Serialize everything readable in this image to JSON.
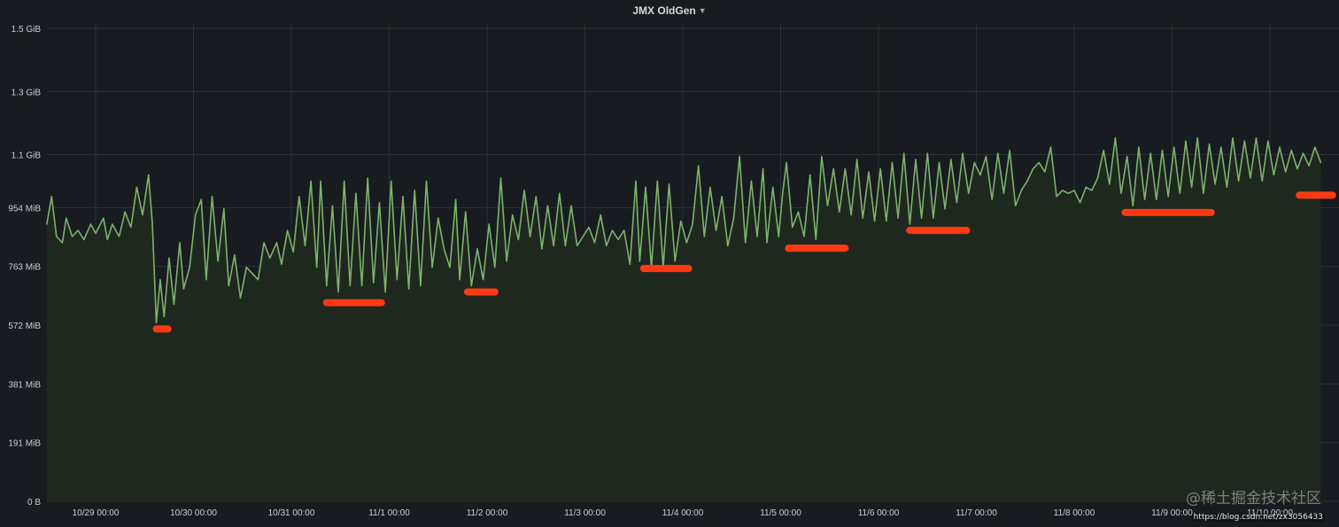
{
  "panel": {
    "title": "JMX OldGen",
    "caret_icon": "caret-down-icon"
  },
  "colors": {
    "background": "#181b1f",
    "series_line": "#7eb26d",
    "series_fill": "#202920",
    "grid": "#2c3036",
    "marker": "#ff3a12"
  },
  "watermark": {
    "text": "@稀土掘金技术社区",
    "url": "https://blog.csdn.net/zx3056433"
  },
  "chart_data": {
    "type": "area",
    "title": "JMX OldGen",
    "xlabel": "",
    "ylabel": "",
    "y_unit": "MiB",
    "ylim": [
      0,
      1536
    ],
    "grid": true,
    "legend": "none",
    "y_ticks": [
      {
        "value": 0,
        "label": "0 B"
      },
      {
        "value": 191,
        "label": "191 MiB"
      },
      {
        "value": 381,
        "label": "381 MiB"
      },
      {
        "value": 572,
        "label": "572 MiB"
      },
      {
        "value": 763,
        "label": "763 MiB"
      },
      {
        "value": 954,
        "label": "954 MiB"
      },
      {
        "value": 1126,
        "label": "1.1 GiB"
      },
      {
        "value": 1331,
        "label": "1.3 GiB"
      },
      {
        "value": 1536,
        "label": "1.5 GiB"
      }
    ],
    "x_range_days": [
      "10/28 13:00",
      "11/10 13:00"
    ],
    "x_ticks": [
      {
        "day": 1,
        "label": "10/29 00:00"
      },
      {
        "day": 2,
        "label": "10/30 00:00"
      },
      {
        "day": 3,
        "label": "10/31 00:00"
      },
      {
        "day": 4,
        "label": "11/1 00:00"
      },
      {
        "day": 5,
        "label": "11/2 00:00"
      },
      {
        "day": 6,
        "label": "11/3 00:00"
      },
      {
        "day": 7,
        "label": "11/4 00:00"
      },
      {
        "day": 8,
        "label": "11/5 00:00"
      },
      {
        "day": 9,
        "label": "11/6 00:00"
      },
      {
        "day": 10,
        "label": "11/7 00:00"
      },
      {
        "day": 11,
        "label": "11/8 00:00"
      },
      {
        "day": 12,
        "label": "11/9 00:00"
      },
      {
        "day": 13,
        "label": "11/10 00:00"
      }
    ],
    "series": [
      {
        "name": "",
        "points": [
          [
            0.0,
            930
          ],
          [
            0.05,
            960
          ],
          [
            0.08,
            820
          ],
          [
            0.12,
            860
          ],
          [
            0.18,
            800
          ],
          [
            0.25,
            860
          ],
          [
            0.3,
            820
          ],
          [
            0.38,
            880
          ],
          [
            0.45,
            860
          ],
          [
            0.5,
            900
          ],
          [
            0.55,
            990
          ],
          [
            0.6,
            860
          ],
          [
            0.66,
            840
          ],
          [
            0.7,
            920
          ],
          [
            0.76,
            860
          ],
          [
            0.82,
            880
          ],
          [
            0.88,
            850
          ],
          [
            0.95,
            900
          ],
          [
            1.0,
            870
          ],
          [
            1.08,
            920
          ],
          [
            1.12,
            850
          ],
          [
            1.17,
            900
          ],
          [
            1.24,
            860
          ],
          [
            1.3,
            940
          ],
          [
            1.36,
            890
          ],
          [
            1.42,
            1020
          ],
          [
            1.48,
            930
          ],
          [
            1.54,
            1060
          ],
          [
            1.58,
            900
          ],
          [
            1.62,
            580
          ],
          [
            1.66,
            720
          ],
          [
            1.7,
            600
          ],
          [
            1.75,
            790
          ],
          [
            1.8,
            640
          ],
          [
            1.86,
            840
          ],
          [
            1.9,
            690
          ],
          [
            1.96,
            760
          ],
          [
            2.02,
            930
          ],
          [
            2.08,
            980
          ],
          [
            2.13,
            720
          ],
          [
            2.19,
            990
          ],
          [
            2.25,
            780
          ],
          [
            2.31,
            950
          ],
          [
            2.36,
            700
          ],
          [
            2.42,
            800
          ],
          [
            2.48,
            660
          ],
          [
            2.54,
            760
          ],
          [
            2.6,
            740
          ],
          [
            2.66,
            720
          ],
          [
            2.72,
            840
          ],
          [
            2.78,
            790
          ],
          [
            2.85,
            840
          ],
          [
            2.9,
            770
          ],
          [
            2.96,
            880
          ],
          [
            3.02,
            810
          ],
          [
            3.08,
            990
          ],
          [
            3.14,
            830
          ],
          [
            3.2,
            1040
          ],
          [
            3.26,
            760
          ],
          [
            3.3,
            1040
          ],
          [
            3.36,
            700
          ],
          [
            3.42,
            960
          ],
          [
            3.48,
            680
          ],
          [
            3.54,
            1040
          ],
          [
            3.6,
            700
          ],
          [
            3.66,
            1000
          ],
          [
            3.72,
            700
          ],
          [
            3.78,
            1050
          ],
          [
            3.84,
            710
          ],
          [
            3.9,
            970
          ],
          [
            3.96,
            680
          ],
          [
            4.02,
            1040
          ],
          [
            4.08,
            720
          ],
          [
            4.14,
            990
          ],
          [
            4.2,
            690
          ],
          [
            4.26,
            1010
          ],
          [
            4.32,
            700
          ],
          [
            4.38,
            1040
          ],
          [
            4.44,
            760
          ],
          [
            4.5,
            920
          ],
          [
            4.56,
            820
          ],
          [
            4.62,
            760
          ],
          [
            4.68,
            980
          ],
          [
            4.72,
            720
          ],
          [
            4.78,
            940
          ],
          [
            4.84,
            700
          ],
          [
            4.9,
            820
          ],
          [
            4.96,
            720
          ],
          [
            5.02,
            900
          ],
          [
            5.08,
            760
          ],
          [
            5.14,
            1050
          ],
          [
            5.2,
            780
          ],
          [
            5.26,
            930
          ],
          [
            5.32,
            850
          ],
          [
            5.38,
            1010
          ],
          [
            5.44,
            860
          ],
          [
            5.5,
            990
          ],
          [
            5.56,
            820
          ],
          [
            5.62,
            960
          ],
          [
            5.68,
            830
          ],
          [
            5.74,
            1000
          ],
          [
            5.8,
            830
          ],
          [
            5.86,
            960
          ],
          [
            5.92,
            830
          ],
          [
            5.98,
            860
          ],
          [
            6.04,
            890
          ],
          [
            6.1,
            840
          ],
          [
            6.16,
            930
          ],
          [
            6.22,
            830
          ],
          [
            6.28,
            880
          ],
          [
            6.34,
            850
          ],
          [
            6.4,
            880
          ],
          [
            6.46,
            770
          ],
          [
            6.52,
            1040
          ],
          [
            6.56,
            780
          ],
          [
            6.62,
            1020
          ],
          [
            6.68,
            760
          ],
          [
            6.74,
            1040
          ],
          [
            6.8,
            760
          ],
          [
            6.86,
            1030
          ],
          [
            6.92,
            780
          ],
          [
            6.98,
            910
          ],
          [
            7.04,
            840
          ],
          [
            7.1,
            900
          ],
          [
            7.16,
            1090
          ],
          [
            7.22,
            860
          ],
          [
            7.28,
            1020
          ],
          [
            7.34,
            880
          ],
          [
            7.4,
            990
          ],
          [
            7.46,
            830
          ],
          [
            7.52,
            920
          ],
          [
            7.58,
            1120
          ],
          [
            7.64,
            840
          ],
          [
            7.7,
            1040
          ],
          [
            7.76,
            860
          ],
          [
            7.82,
            1080
          ],
          [
            7.86,
            840
          ],
          [
            7.92,
            1020
          ],
          [
            7.98,
            860
          ],
          [
            8.02,
            1000
          ],
          [
            8.06,
            1100
          ],
          [
            8.12,
            890
          ],
          [
            8.18,
            940
          ],
          [
            8.24,
            860
          ],
          [
            8.3,
            1060
          ],
          [
            8.36,
            850
          ],
          [
            8.42,
            1120
          ],
          [
            8.48,
            960
          ],
          [
            8.54,
            1080
          ],
          [
            8.6,
            940
          ],
          [
            8.66,
            1080
          ],
          [
            8.72,
            930
          ],
          [
            8.78,
            1110
          ],
          [
            8.84,
            920
          ],
          [
            8.9,
            1070
          ],
          [
            8.96,
            910
          ],
          [
            9.02,
            1080
          ],
          [
            9.08,
            910
          ],
          [
            9.14,
            1100
          ],
          [
            9.2,
            920
          ],
          [
            9.26,
            1130
          ],
          [
            9.32,
            900
          ],
          [
            9.38,
            1110
          ],
          [
            9.44,
            920
          ],
          [
            9.5,
            1130
          ],
          [
            9.56,
            920
          ],
          [
            9.62,
            1100
          ],
          [
            9.68,
            950
          ],
          [
            9.74,
            1110
          ],
          [
            9.8,
            970
          ],
          [
            9.86,
            1130
          ],
          [
            9.92,
            1000
          ],
          [
            9.98,
            1100
          ],
          [
            10.04,
            1060
          ],
          [
            10.1,
            1120
          ],
          [
            10.16,
            980
          ],
          [
            10.22,
            1130
          ],
          [
            10.28,
            1000
          ],
          [
            10.34,
            1140
          ],
          [
            10.4,
            960
          ],
          [
            10.46,
            1010
          ],
          [
            10.52,
            1040
          ],
          [
            10.58,
            1080
          ],
          [
            10.64,
            1100
          ],
          [
            10.7,
            1070
          ],
          [
            10.76,
            1150
          ],
          [
            10.82,
            990
          ],
          [
            10.88,
            1010
          ],
          [
            10.94,
            1000
          ],
          [
            11.0,
            1010
          ],
          [
            11.06,
            970
          ],
          [
            11.12,
            1020
          ],
          [
            11.18,
            1010
          ],
          [
            11.24,
            1050
          ],
          [
            11.3,
            1140
          ],
          [
            11.36,
            1030
          ],
          [
            11.42,
            1180
          ],
          [
            11.48,
            1000
          ],
          [
            11.54,
            1120
          ],
          [
            11.6,
            960
          ],
          [
            11.66,
            1150
          ],
          [
            11.72,
            980
          ],
          [
            11.78,
            1130
          ],
          [
            11.84,
            980
          ],
          [
            11.9,
            1140
          ],
          [
            11.96,
            990
          ],
          [
            12.02,
            1150
          ],
          [
            12.08,
            1000
          ],
          [
            12.14,
            1170
          ],
          [
            12.2,
            1020
          ],
          [
            12.26,
            1180
          ],
          [
            12.32,
            1000
          ],
          [
            12.38,
            1160
          ],
          [
            12.44,
            1030
          ],
          [
            12.5,
            1150
          ],
          [
            12.56,
            1020
          ],
          [
            12.62,
            1180
          ],
          [
            12.68,
            1040
          ],
          [
            12.74,
            1170
          ],
          [
            12.8,
            1050
          ],
          [
            12.86,
            1180
          ],
          [
            12.92,
            1040
          ],
          [
            12.98,
            1170
          ],
          [
            13.04,
            1060
          ],
          [
            13.1,
            1150
          ],
          [
            13.16,
            1070
          ],
          [
            13.22,
            1140
          ],
          [
            13.28,
            1080
          ],
          [
            13.34,
            1130
          ],
          [
            13.4,
            1090
          ],
          [
            13.46,
            1150
          ],
          [
            13.52,
            1100
          ]
        ]
      }
    ],
    "annotations": [
      {
        "type": "marker",
        "x": [
          1.62,
          1.74
        ],
        "y": 560
      },
      {
        "type": "marker",
        "x": [
          3.36,
          3.92
        ],
        "y": 645
      },
      {
        "type": "marker",
        "x": [
          4.8,
          5.08
        ],
        "y": 680
      },
      {
        "type": "marker",
        "x": [
          6.6,
          7.06
        ],
        "y": 756
      },
      {
        "type": "marker",
        "x": [
          8.08,
          8.66
        ],
        "y": 822
      },
      {
        "type": "marker",
        "x": [
          9.32,
          9.9
        ],
        "y": 880
      },
      {
        "type": "marker",
        "x": [
          11.52,
          12.4
        ],
        "y": 938
      },
      {
        "type": "marker",
        "x": [
          13.3,
          13.64
        ],
        "y": 994
      }
    ]
  }
}
